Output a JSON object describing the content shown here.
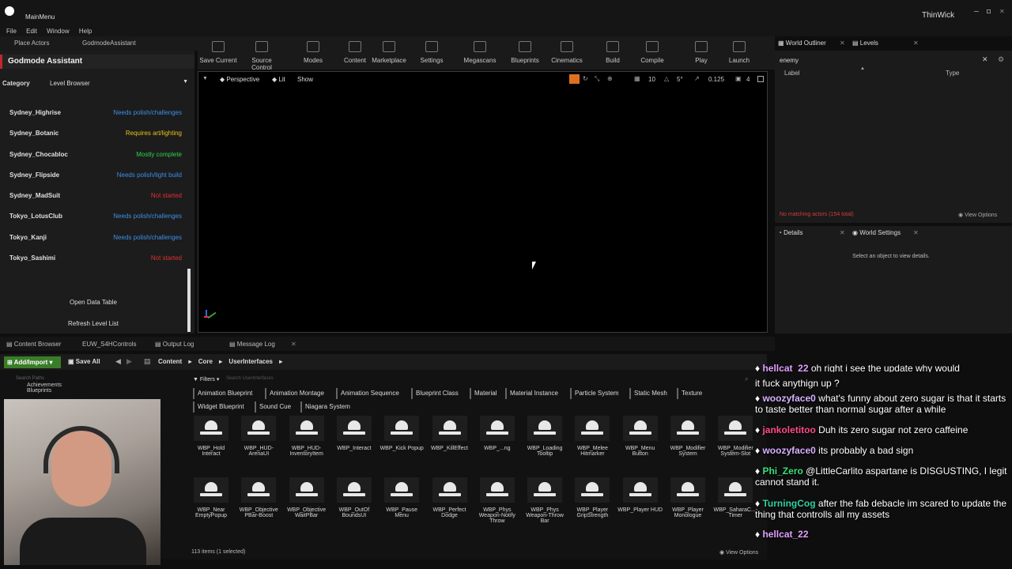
{
  "title": {
    "map_name": "MainMenu",
    "project": "ThinWick"
  },
  "menu": [
    "File",
    "Edit",
    "Window",
    "Help"
  ],
  "top_tabs": {
    "place_actors": "Place Actors",
    "godmode_tab": "GodmodeAssistant"
  },
  "toolbar": [
    "Save Current",
    "Source Control",
    "Modes",
    "Content",
    "Marketplace",
    "Settings",
    "Megascans",
    "Blueprints",
    "Cinematics",
    "Build",
    "Compile",
    "Play",
    "Launch"
  ],
  "left_panel": {
    "title": "Godmode Assistant",
    "category_label": "Category",
    "category_value": "Level Browser",
    "levels": [
      {
        "name": "Sydney_Highrise",
        "status": "Needs polish/challenges",
        "color": "#3d8fe8"
      },
      {
        "name": "Sydney_Botanic",
        "status": "Requires art/lighting",
        "color": "#e8c21a"
      },
      {
        "name": "Sydney_Chocabloc",
        "status": "Mostly complete",
        "color": "#29d64a"
      },
      {
        "name": "Sydney_Flipside",
        "status": "Needs polish/light build",
        "color": "#3d8fe8"
      },
      {
        "name": "Sydney_MadSuit",
        "status": "Not started",
        "color": "#e03030"
      },
      {
        "name": "Tokyo_LotusClub",
        "status": "Needs polish/challenges",
        "color": "#3d8fe8"
      },
      {
        "name": "Tokyo_Kanji",
        "status": "Needs polish/challenges",
        "color": "#3d8fe8"
      },
      {
        "name": "Tokyo_Sashimi",
        "status": "Not started",
        "color": "#e03030"
      }
    ],
    "open_table": "Open Data Table",
    "refresh": "Refresh Level List"
  },
  "viewport": {
    "perspective": "Perspective",
    "lit": "Lit",
    "show": "Show",
    "grid": "10",
    "angle": "5°",
    "scale": "0.125",
    "cam": "4"
  },
  "outliner": {
    "tab1": "World Outliner",
    "tab2": "Levels",
    "search": "enemy",
    "col_label": "Label",
    "col_type": "Type",
    "status": "No matching actors (154 total)",
    "view_options": "View Options"
  },
  "details": {
    "tab1": "Details",
    "tab2": "World Settings",
    "empty": "Select an object to view details."
  },
  "bottom_tabs": [
    "Content Browser",
    "EUW_S4HControls",
    "Output Log",
    "Message Log"
  ],
  "content_browser": {
    "add_import": "Add/Import",
    "save_all": "Save All",
    "path": [
      "Content",
      "Core",
      "UserInterfaces"
    ],
    "search_paths": "Search Paths",
    "search_placeholder": "Search UserInterfaces",
    "filters": "Filters",
    "folder_items": [
      "Achievements",
      "Blueprints"
    ],
    "filter_chips": [
      "Animation Blueprint",
      "Animation Montage",
      "Animation Sequence",
      "Blueprint Class",
      "Material",
      "Material Instance",
      "Particle System",
      "Static Mesh",
      "Texture",
      "Widget Blueprint",
      "Sound Cue",
      "Niagara System"
    ],
    "assets_row1": [
      "WBP_Hold Interact",
      "WBP_HUD-ArenaUI",
      "WBP_HUD-InventoryItem",
      "WBP_Interact",
      "WBP_Kick Popup",
      "WBP_KillEffect",
      "WBP_...ng",
      "WBP_Loading Tooltip",
      "WBP_Melee Hitmarker",
      "WBP_Menu Button",
      "WBP_Modifier System",
      "WBP_Modifier System-Slot"
    ],
    "assets_row2": [
      "WBP_Near EmptyPopup",
      "WBP_Objective PBar-Boost",
      "WBP_Objective WaitPBar",
      "WBP_OutOf BoundsUI",
      "WBP_Pause Menu",
      "WBP_Perfect Dodge",
      "WBP_Phys Weapon-Notify Throw",
      "WBP_Phys Weapon-Throw Bar",
      "WBP_Player GripStrength",
      "WBP_Player HUD",
      "WBP_Player Monologue",
      "WBP_SaharaC...-Timer"
    ],
    "item_count": "113 items (1 selected)",
    "view_options": "View Options"
  },
  "chat": [
    {
      "user": "hellcat_22",
      "text": "oh right i see the update why would",
      "color": "#e0a0ff"
    },
    {
      "user": "woozyface0",
      "text": "what's funny about zero sugar is that it starts to taste better than normal sugar after a while",
      "color": "#d8b0ff"
    },
    {
      "user": "jankoletitoo",
      "text": "Duh its zero sugar not zero caffeine",
      "color": "#ff4b8c"
    },
    {
      "user": "woozyface0",
      "text": "its probably a bad sign",
      "color": "#d8b0ff"
    },
    {
      "user": "Phi_Zero",
      "text": "@LittleCarlito aspartane is DISGUSTING, I legit cannot stand it.",
      "color": "#38e07a"
    },
    {
      "user": "TurningCog",
      "text": "after the fab debacle im scared to update the thing that controlls all my assets",
      "color": "#30d0a0"
    },
    {
      "user": "hellcat_22",
      "text": "",
      "color": "#e0a0ff"
    }
  ],
  "chat_prefix_line": "it fuck anythign up ?"
}
